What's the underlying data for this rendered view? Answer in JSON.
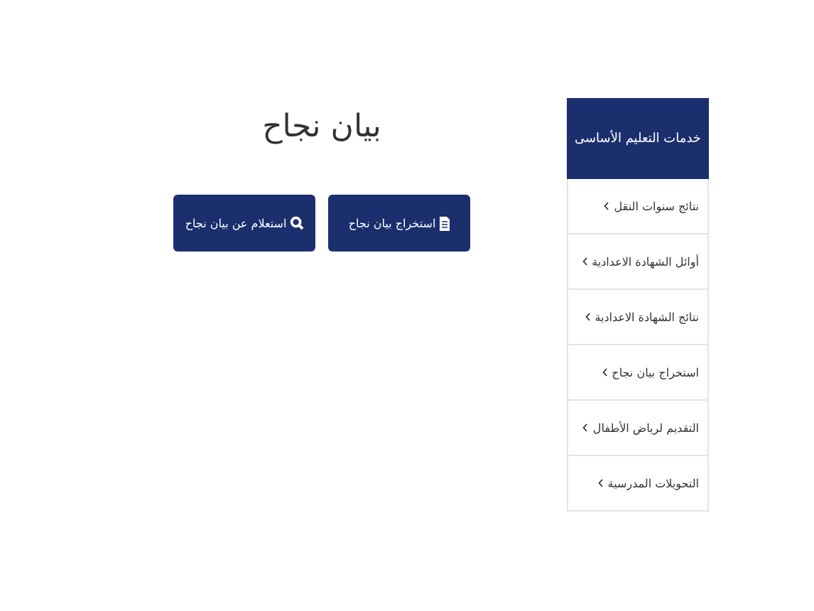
{
  "sidebar": {
    "title": "خدمات التعليم الأساسى",
    "items": [
      {
        "label": "نتائج سنوات النقل"
      },
      {
        "label": "أوائل الشهادة الاعدادية"
      },
      {
        "label": "نتائج الشهادة الاعدادية"
      },
      {
        "label": "استخراج بيان نجاح"
      },
      {
        "label": "التقديم لرياض الأطفال"
      },
      {
        "label": "التحويلات المدرسية"
      }
    ]
  },
  "main": {
    "title": "بيان نجاح",
    "buttons": [
      {
        "label": "استخراج بيان نجاح",
        "kind": "document"
      },
      {
        "label": "استعلام عن بيان نجاح",
        "kind": "search"
      }
    ]
  }
}
